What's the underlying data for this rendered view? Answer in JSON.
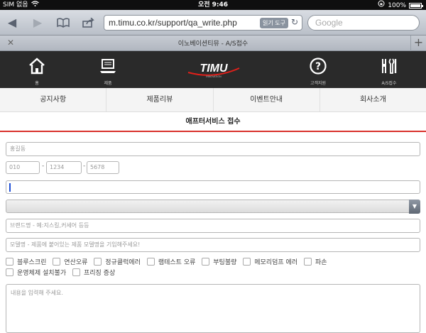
{
  "status_bar": {
    "carrier": "SIM 없음",
    "time": "오전 9:46",
    "battery": "100%"
  },
  "browser": {
    "url": "m.timu.co.kr/support/qa_write.php",
    "reader_label": "읽기 도구",
    "search_placeholder": "Google",
    "tab_title": "이노베이션티뮤 - A/S접수"
  },
  "header": {
    "logo_text": "TIMU",
    "logo_sub": "INNOVATION",
    "nav": [
      {
        "label": "홈",
        "icon": "home-icon"
      },
      {
        "label": "제품",
        "icon": "laptop-icon"
      },
      {
        "label": "고객지원",
        "icon": "help-icon"
      },
      {
        "label": "A/S접수",
        "icon": "tools-icon"
      }
    ]
  },
  "main_nav": [
    "공지사항",
    "제품리뷰",
    "이벤트안내",
    "회사소개"
  ],
  "page_title": "애프터서비스 접수",
  "form": {
    "name_placeholder": "홍길동",
    "phone": [
      "010",
      "1234",
      "5678"
    ],
    "email_value": "",
    "select_value": "",
    "brand_placeholder": "브랜드명 - 예:지스킬,커세어 등등",
    "model_placeholder": "모델명 - 제품에 붙어있는 제품 모델명을 기입해주세요!",
    "symptoms_row1": [
      "블루스크린",
      "연산오류",
      "정규클럭에러",
      "램테스트 오류",
      "부팅불량",
      "메모리덤프 에러",
      "파손"
    ],
    "symptoms_row2": [
      "운영체제 설치불가",
      "프리징 증상"
    ],
    "content_placeholder": "내용을 입력해 주세요."
  }
}
